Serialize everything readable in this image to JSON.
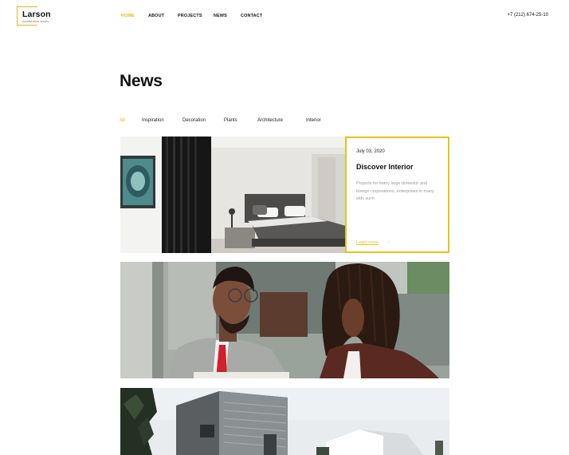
{
  "brand": {
    "name": "Larson",
    "tagline": "Architecture studio"
  },
  "nav": [
    {
      "label": "Home",
      "active": true
    },
    {
      "label": "About",
      "active": false
    },
    {
      "label": "Projects",
      "active": false
    },
    {
      "label": "News",
      "active": false
    },
    {
      "label": "Contact",
      "active": false
    }
  ],
  "phone": "+7 (212) 674-25-10",
  "page": {
    "title": "News"
  },
  "filters": [
    {
      "label": "All",
      "active": true
    },
    {
      "label": "Inspiration",
      "active": false
    },
    {
      "label": "Decoration",
      "active": false
    },
    {
      "label": "Plants",
      "active": false
    },
    {
      "label": "Architecture",
      "active": false
    },
    {
      "label": "Interior",
      "active": false
    }
  ],
  "featured": {
    "date": "July 03, 2020",
    "title": "Discover Interior",
    "excerpt": "Projects for many large domestic and foreign corporations, enterprises in many elds such",
    "link_label": "Learn more",
    "link_icon": "arrow-right-icon"
  },
  "colors": {
    "accent": "#e5b80b",
    "text": "#111111",
    "muted": "#9a9a9a"
  }
}
